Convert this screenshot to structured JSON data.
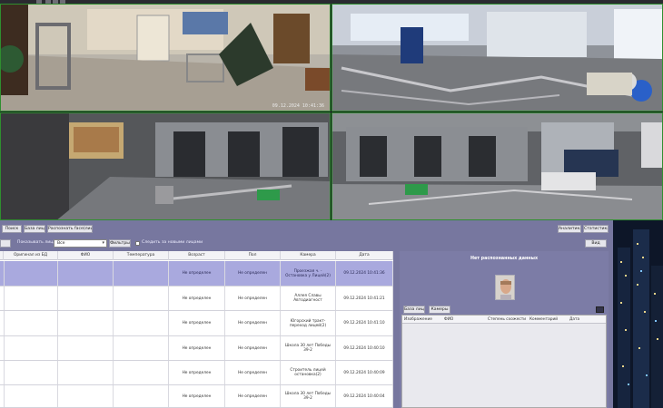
{
  "toolbar": {
    "search": "Поиск",
    "face_db": "База лиц",
    "recognize_face_reg": "Распознать face(лица)",
    "analytics": "Аналитика",
    "statistics": "Статистика",
    "view": "Вид"
  },
  "filters": {
    "show_faces_label": "Показывать лица",
    "show_faces_value": "Все",
    "filters_button": "Фильтры",
    "new_faces_label": "Следить за новыми лицами"
  },
  "cameras": [
    {
      "stamp": "09.12.2024 10:41:36"
    },
    {
      "stamp": ""
    },
    {
      "stamp": ""
    },
    {
      "stamp": ""
    }
  ],
  "table": {
    "columns": [
      "",
      "Оригинал из БД",
      "ФИО",
      "Температура",
      "Возраст",
      "Пол",
      "Камера",
      "Дата"
    ],
    "rows": [
      {
        "age": "Не определен",
        "sex": "Не определен",
        "camera": "Проезжая ч. - Остановка у Лицей(2)",
        "date": "09.12.2024 10:41:36",
        "selected": true
      },
      {
        "age": "Не определен",
        "sex": "Не определен",
        "camera": "Аллея Славы Автодиагност",
        "date": "09.12.2024 10:41:21",
        "selected": false
      },
      {
        "age": "Не определен",
        "sex": "Не определен",
        "camera": "Югорский тракт-переход лицей(2)",
        "date": "09.12.2024 10:41:10",
        "selected": false
      },
      {
        "age": "Не определен",
        "sex": "Не определен",
        "camera": "Школа 30 лет Победы 39-2",
        "date": "09.12.2024 10:40:10",
        "selected": false
      },
      {
        "age": "Не определен",
        "sex": "Не определен",
        "camera": "Строитель лицей остановка(2)",
        "date": "09.12.2024 10:40:09",
        "selected": false
      },
      {
        "age": "Не определен",
        "sex": "Не определен",
        "camera": "Школа 30 лет Победы 39-2",
        "date": "09.12.2024 10:40:04",
        "selected": false
      }
    ]
  },
  "info": {
    "no_data": "Нет распознанных данных",
    "face_db_button": "База лиц",
    "cameras_button": "Камеры",
    "columns": [
      "Изображение",
      "ФИО",
      "Степень схожести",
      "Комментарий",
      "Дата"
    ]
  }
}
